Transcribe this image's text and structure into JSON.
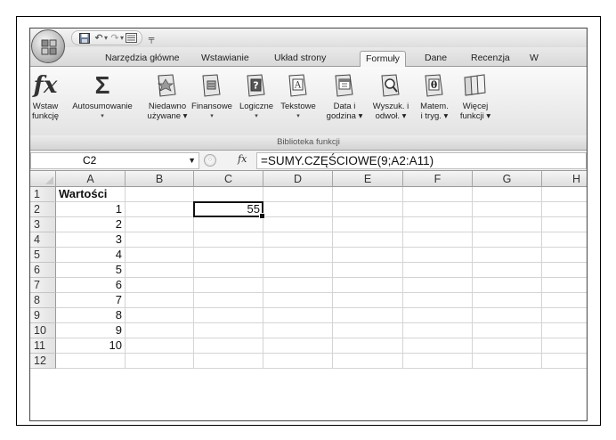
{
  "tabs": [
    "Narzędzia główne",
    "Wstawianie",
    "Układ strony",
    "Formuły",
    "Dane",
    "Recenzja",
    "W"
  ],
  "active_tab": "Formuły",
  "ribbon": {
    "insert_function": {
      "line1": "Wstaw",
      "line2": "funkcję"
    },
    "autosum": {
      "line1": "Autosumowanie",
      "line2": "▾"
    },
    "recent": {
      "line1": "Niedawno",
      "line2": "używane ▾"
    },
    "financial": {
      "line1": "Finansowe",
      "line2": "▾"
    },
    "logical": {
      "line1": "Logiczne",
      "line2": "▾"
    },
    "text": {
      "line1": "Tekstowe",
      "line2": "▾"
    },
    "datetime": {
      "line1": "Data i",
      "line2": "godzina ▾"
    },
    "lookup": {
      "line1": "Wyszuk. i",
      "line2": "odwoł. ▾"
    },
    "math": {
      "line1": "Matem.",
      "line2": "i tryg. ▾"
    },
    "more": {
      "line1": "Więcej",
      "line2": "funkcji ▾"
    },
    "group_label": "Biblioteka funkcji"
  },
  "formula_bar": {
    "name_box": "C2",
    "fx_symbol": "fx",
    "formula": "=SUMY.CZĘŚCIOWE(9;A2:A11)"
  },
  "columns": [
    "A",
    "B",
    "C",
    "D",
    "E",
    "F",
    "G",
    "H"
  ],
  "rows": [
    "1",
    "2",
    "3",
    "4",
    "5",
    "6",
    "7",
    "8",
    "9",
    "10",
    "11",
    "12"
  ],
  "cells": {
    "A1": "Wartości",
    "A2": "1",
    "A3": "2",
    "A4": "3",
    "A5": "4",
    "A6": "5",
    "A7": "6",
    "A8": "7",
    "A9": "8",
    "A10": "9",
    "A11": "10",
    "C2": "55"
  },
  "selected_cell": "C2"
}
